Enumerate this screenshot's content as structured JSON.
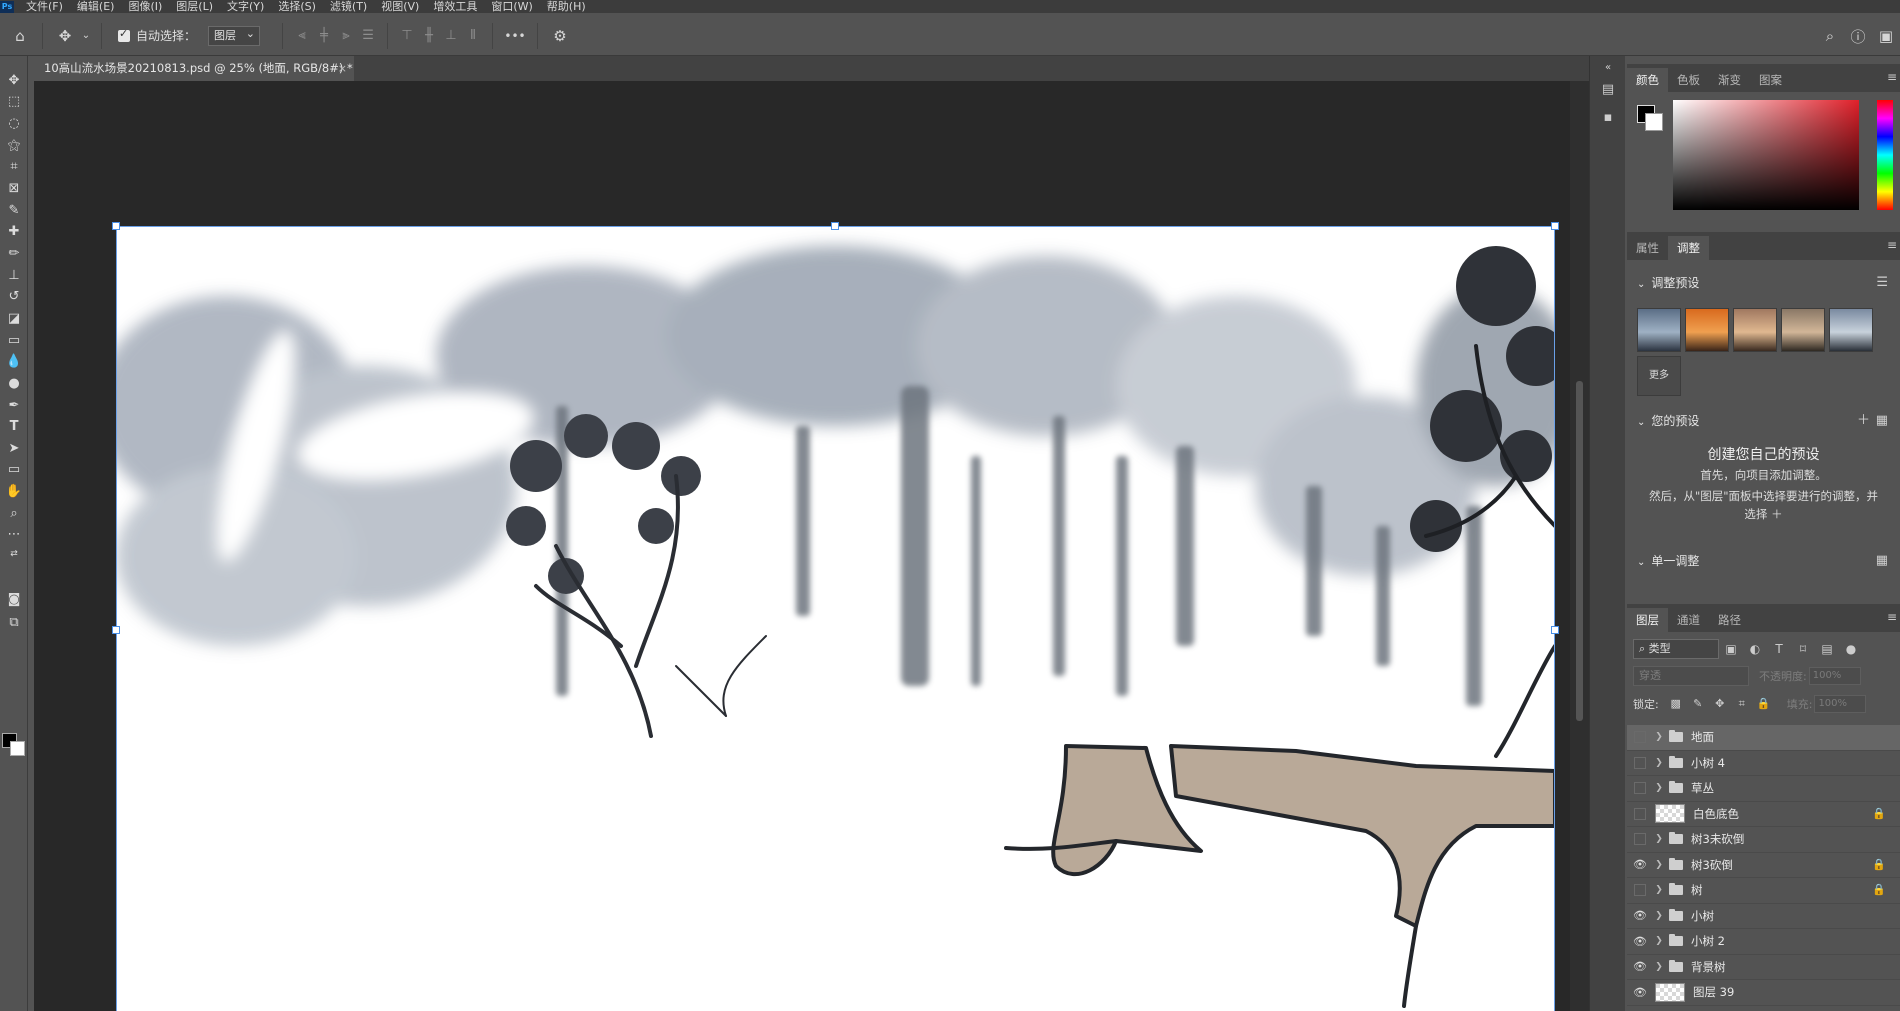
{
  "menu": {
    "logo": "Ps",
    "items": [
      "文件(F)",
      "编辑(E)",
      "图像(I)",
      "图层(L)",
      "文字(Y)",
      "选择(S)",
      "滤镜(T)",
      "视图(V)",
      "增效工具",
      "窗口(W)",
      "帮助(H)"
    ]
  },
  "options": {
    "auto_select_label": "自动选择：",
    "auto_select_checked": true,
    "auto_select_target": "图层",
    "more_label": "•••"
  },
  "document": {
    "tab_title": "10高山流水场景20210813.psd @ 25% (地面, RGB/8#) *",
    "close": "×"
  },
  "colors": {
    "foreground": "#000000",
    "background": "#ffffff",
    "ui_bg": "#535353",
    "canvas_bg": "#282828",
    "accent": "#31a8ff"
  },
  "color_panel": {
    "tabs": [
      "颜色",
      "色板",
      "渐变",
      "图案"
    ],
    "active_tab": "颜色"
  },
  "adjust_panel": {
    "tabs": [
      "属性",
      "调整"
    ],
    "active_tab": "调整",
    "presets_header": "调整预设",
    "more_label": "更多",
    "your_presets_header": "您的预设",
    "create_title": "创建您自己的预设",
    "create_line1": "首先，向项目添加调整。",
    "create_line2": "然后，从\"图层\"面板中选择要进行的调整，并",
    "create_line3": "选择 ＋",
    "single_adjust_header": "单一调整"
  },
  "layers_panel": {
    "tabs": [
      "图层",
      "通道",
      "路径"
    ],
    "active_tab": "图层",
    "kind_filter": "类型",
    "blend_mode": "穿透",
    "opacity_label": "不透明度:",
    "opacity_value": "100%",
    "lock_label": "锁定:",
    "fill_label": "填充:",
    "fill_value": "100%",
    "layers": [
      {
        "name": "地面",
        "type": "group",
        "visible": false,
        "locked": false,
        "selected": true
      },
      {
        "name": "小树 4",
        "type": "group",
        "visible": false,
        "locked": false,
        "selected": false
      },
      {
        "name": "草丛",
        "type": "group",
        "visible": false,
        "locked": false,
        "selected": false
      },
      {
        "name": "白色底色",
        "type": "pixel",
        "visible": false,
        "locked": true,
        "selected": false
      },
      {
        "name": "树3未砍倒",
        "type": "group",
        "visible": false,
        "locked": false,
        "selected": false
      },
      {
        "name": "树3砍倒",
        "type": "group",
        "visible": true,
        "locked": true,
        "selected": false
      },
      {
        "name": "树",
        "type": "group",
        "visible": false,
        "locked": true,
        "selected": false
      },
      {
        "name": "小树",
        "type": "group",
        "visible": true,
        "locked": false,
        "selected": false
      },
      {
        "name": "小树 2",
        "type": "group",
        "visible": true,
        "locked": false,
        "selected": false
      },
      {
        "name": "背景树",
        "type": "group",
        "visible": true,
        "locked": false,
        "selected": false
      },
      {
        "name": "图层 39",
        "type": "pixel",
        "visible": true,
        "locked": false,
        "selected": false
      }
    ]
  },
  "icons": {
    "home": "home-icon",
    "move": "move-icon",
    "search": "search-icon",
    "help": "help-icon",
    "workspace": "workspace-icon",
    "settings": "gear-icon"
  }
}
